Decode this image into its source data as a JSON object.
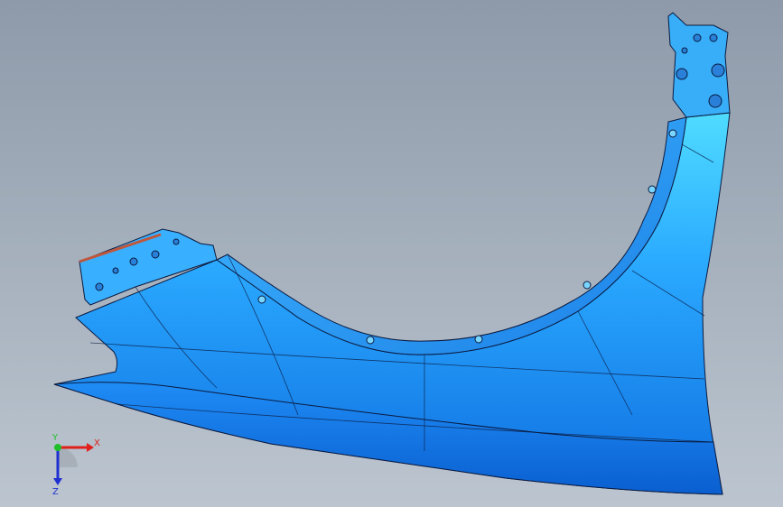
{
  "viewport": {
    "background_top": "#8e9aaa",
    "background_bottom": "#bcc5cf"
  },
  "model": {
    "part_color": "#1a8fff",
    "highlight_color": "#52d8ff",
    "edge_color": "#0a1a40"
  },
  "triad": {
    "x_label": "X",
    "y_label": "Y",
    "z_label": "Z",
    "x_color": "#e0201a",
    "y_color": "#1fbf2a",
    "z_color": "#2030d0"
  }
}
